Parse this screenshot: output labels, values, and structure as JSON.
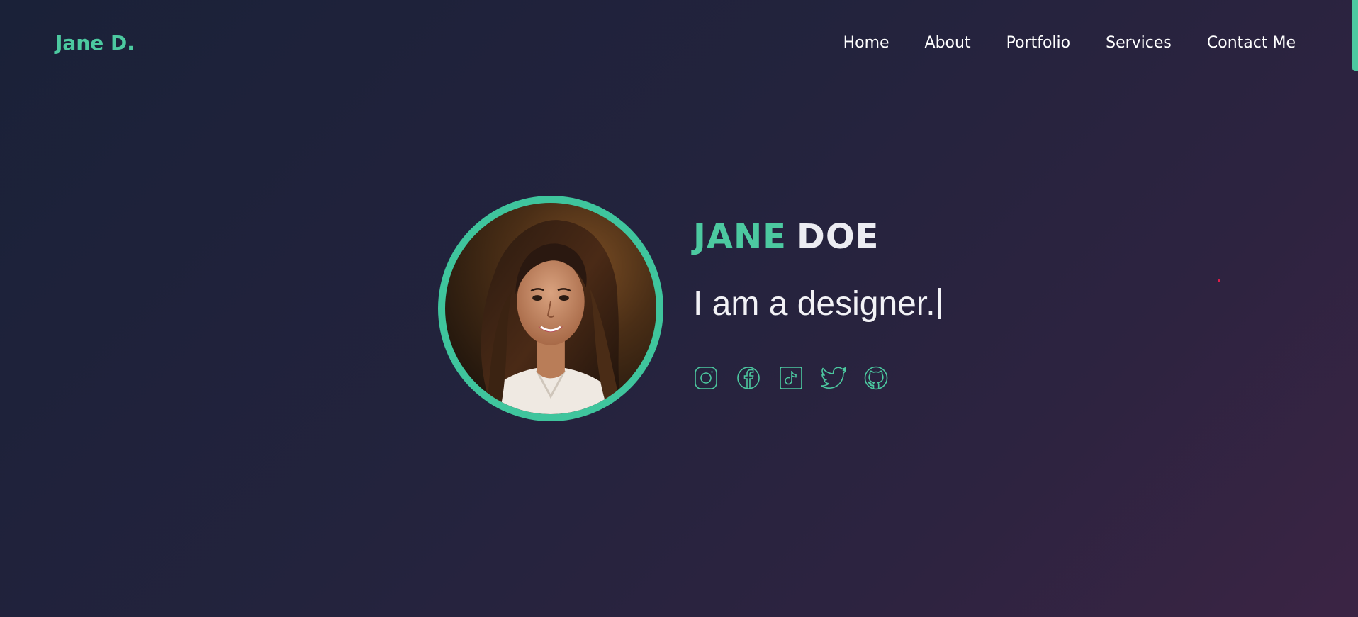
{
  "brand": {
    "label": "Jane D."
  },
  "nav": {
    "items": [
      {
        "label": "Home"
      },
      {
        "label": "About"
      },
      {
        "label": "Portfolio"
      },
      {
        "label": "Services"
      },
      {
        "label": "Contact Me"
      }
    ]
  },
  "hero": {
    "first_name": "JANE",
    "last_name": "DOE",
    "tagline": "I am a designer.",
    "avatar_icon": "portrait-photo"
  },
  "socials": [
    {
      "icon": "instagram-icon"
    },
    {
      "icon": "facebook-icon"
    },
    {
      "icon": "tiktok-icon"
    },
    {
      "icon": "twitter-icon"
    },
    {
      "icon": "github-icon"
    }
  ],
  "colors": {
    "accent": "#4cc9a0",
    "text": "#f1f1f6",
    "background_start": "#1a2138",
    "background_end": "#3b2444"
  }
}
